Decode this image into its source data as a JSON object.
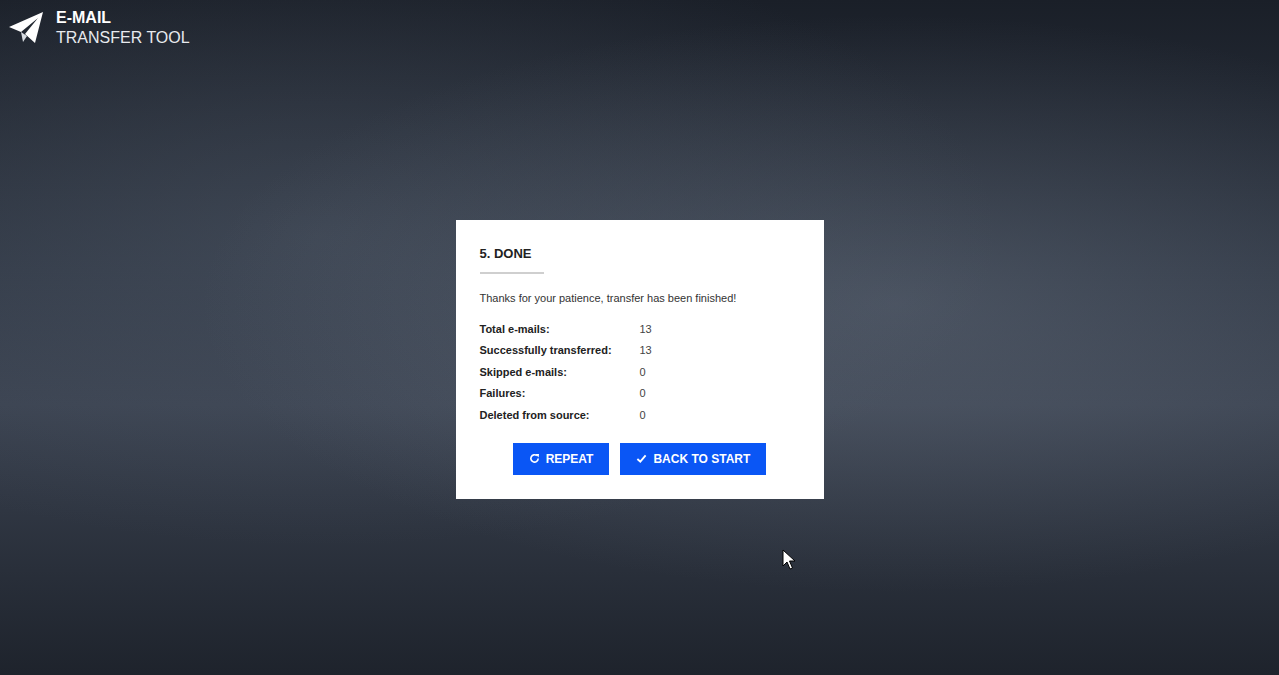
{
  "app": {
    "logo": {
      "title": "E-MAIL",
      "subtitle": "TRANSFER TOOL"
    }
  },
  "dialog": {
    "step": "5. DONE",
    "message": "Thanks for your patience, transfer has been finished!",
    "stats": [
      {
        "label": "Total e-mails:",
        "value": "13"
      },
      {
        "label": "Successfully transferred:",
        "value": "13"
      },
      {
        "label": "Skipped e-mails:",
        "value": "0"
      },
      {
        "label": "Failures:",
        "value": "0"
      },
      {
        "label": "Deleted from source:",
        "value": "0"
      }
    ],
    "buttons": [
      {
        "label": "REPEAT",
        "kind": "repeat"
      },
      {
        "label": "BACK TO START",
        "kind": "confirm"
      }
    ]
  }
}
